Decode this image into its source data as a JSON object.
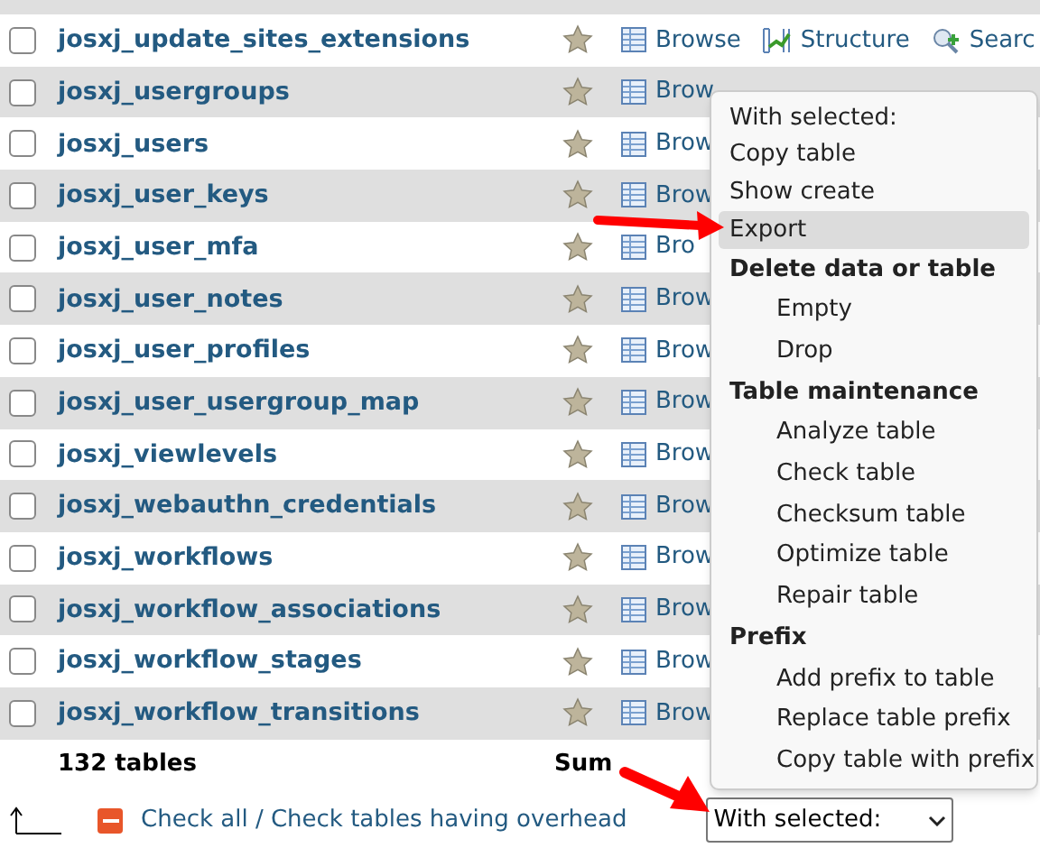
{
  "rows": [
    {
      "name": "josxj_update_sites_extensions",
      "checked": false,
      "actions": [
        "Browse",
        "Structure",
        "Searc"
      ]
    },
    {
      "name": "josxj_usergroups",
      "checked": false,
      "actions": [
        "Brow"
      ]
    },
    {
      "name": "josxj_users",
      "checked": false,
      "actions": [
        "Brow"
      ]
    },
    {
      "name": "josxj_user_keys",
      "checked": false,
      "actions": [
        "Brow"
      ]
    },
    {
      "name": "josxj_user_mfa",
      "checked": false,
      "actions": [
        "Bro"
      ]
    },
    {
      "name": "josxj_user_notes",
      "checked": false,
      "actions": [
        "Brow"
      ]
    },
    {
      "name": "josxj_user_profiles",
      "checked": false,
      "actions": [
        "Brow"
      ]
    },
    {
      "name": "josxj_user_usergroup_map",
      "checked": false,
      "actions": [
        "Brow"
      ]
    },
    {
      "name": "josxj_viewlevels",
      "checked": false,
      "actions": [
        "Brow"
      ]
    },
    {
      "name": "josxj_webauthn_credentials",
      "checked": false,
      "actions": [
        "Brow"
      ]
    },
    {
      "name": "josxj_workflows",
      "checked": false,
      "actions": [
        "Brow"
      ]
    },
    {
      "name": "josxj_workflow_associations",
      "checked": false,
      "actions": [
        "Brow"
      ]
    },
    {
      "name": "josxj_workflow_stages",
      "checked": false,
      "actions": [
        "Brow"
      ]
    },
    {
      "name": "josxj_workflow_transitions",
      "checked": false,
      "actions": [
        "Brow"
      ]
    }
  ],
  "summary": {
    "count": "132 tables",
    "column_2": "Sum"
  },
  "footer": {
    "check_all": "Check all / Check tables having overhead",
    "select_value": "With selected:"
  },
  "menu": {
    "items": [
      {
        "kind": "option",
        "label": "With selected:",
        "selected": false
      },
      {
        "kind": "option",
        "label": "Copy table",
        "selected": false
      },
      {
        "kind": "option",
        "label": "Show create",
        "selected": false
      },
      {
        "kind": "option",
        "label": "Export",
        "selected": true
      },
      {
        "kind": "group",
        "label": "Delete data or table",
        "children": [
          {
            "label": "Empty",
            "selected": false
          },
          {
            "label": "Drop",
            "selected": false
          }
        ]
      },
      {
        "kind": "group",
        "label": "Table maintenance",
        "children": [
          {
            "label": "Analyze table",
            "selected": false
          },
          {
            "label": "Check table",
            "selected": false
          },
          {
            "label": "Checksum table",
            "selected": false
          },
          {
            "label": "Optimize table",
            "selected": false
          },
          {
            "label": "Repair table",
            "selected": false
          }
        ]
      },
      {
        "kind": "group",
        "label": "Prefix",
        "children": [
          {
            "label": "Add prefix to table",
            "selected": false
          },
          {
            "label": "Replace table prefix",
            "selected": false
          },
          {
            "label": "Copy table with prefix",
            "selected": false
          }
        ]
      }
    ]
  }
}
